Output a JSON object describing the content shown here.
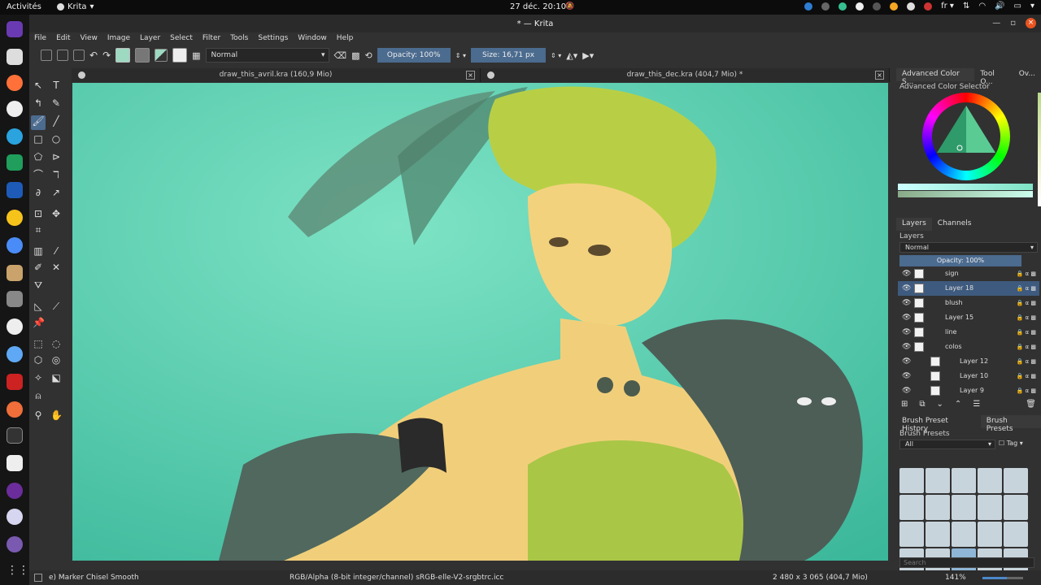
{
  "topbar": {
    "activities": "Activités",
    "app_name": "Krita",
    "clock": "27 déc.  20:10",
    "language": "fr"
  },
  "window": {
    "title": "* — Krita"
  },
  "menu": [
    "File",
    "Edit",
    "View",
    "Image",
    "Layer",
    "Select",
    "Filter",
    "Tools",
    "Settings",
    "Window",
    "Help"
  ],
  "toolbar": {
    "blend_mode": "Normal",
    "opacity": "Opacity: 100%",
    "size": "Size: 16,71 px"
  },
  "tabs": [
    {
      "label": "draw_this_avril.kra (160,9 Mio)"
    },
    {
      "label": "draw_this_dec.kra (404,7 Mio) *"
    }
  ],
  "dockers": {
    "color_tabs": [
      "Advanced Color S...",
      "Tool O...",
      "Ov..."
    ],
    "color_title": "Advanced Color Selector",
    "layer_tabs": [
      "Layers",
      "Channels"
    ],
    "layers_title": "Layers",
    "layer_blend": "Normal",
    "layer_opacity": "Opacity:  100%",
    "layers": [
      {
        "name": "sign",
        "selected": false,
        "indent": false
      },
      {
        "name": "Layer 18",
        "selected": true,
        "indent": false
      },
      {
        "name": "blush",
        "selected": false,
        "indent": false
      },
      {
        "name": "Layer 15",
        "selected": false,
        "indent": false
      },
      {
        "name": "line",
        "selected": false,
        "indent": false
      },
      {
        "name": "colos",
        "selected": false,
        "indent": false
      },
      {
        "name": "Layer 12",
        "selected": false,
        "indent": true
      },
      {
        "name": "Layer 10",
        "selected": false,
        "indent": true
      },
      {
        "name": "Layer 9",
        "selected": false,
        "indent": true
      }
    ],
    "preset_tabs": [
      "Brush Preset History",
      "Brush Presets"
    ],
    "presets_title": "Brush Presets",
    "preset_filter": "All",
    "preset_tag": "Tag",
    "search_placeholder": "Search"
  },
  "status": {
    "brush": "e) Marker Chisel Smooth",
    "color_model": "RGB/Alpha (8-bit integer/channel)  sRGB-elle-V2-srgbtrc.icc",
    "image_size": "2 480 x 3 065 (404,7 Mio)",
    "zoom": "141%"
  },
  "colors": {
    "canvas_bg": "#5fcab0",
    "accent": "#4b6b8f",
    "close_button": "#e95420"
  }
}
